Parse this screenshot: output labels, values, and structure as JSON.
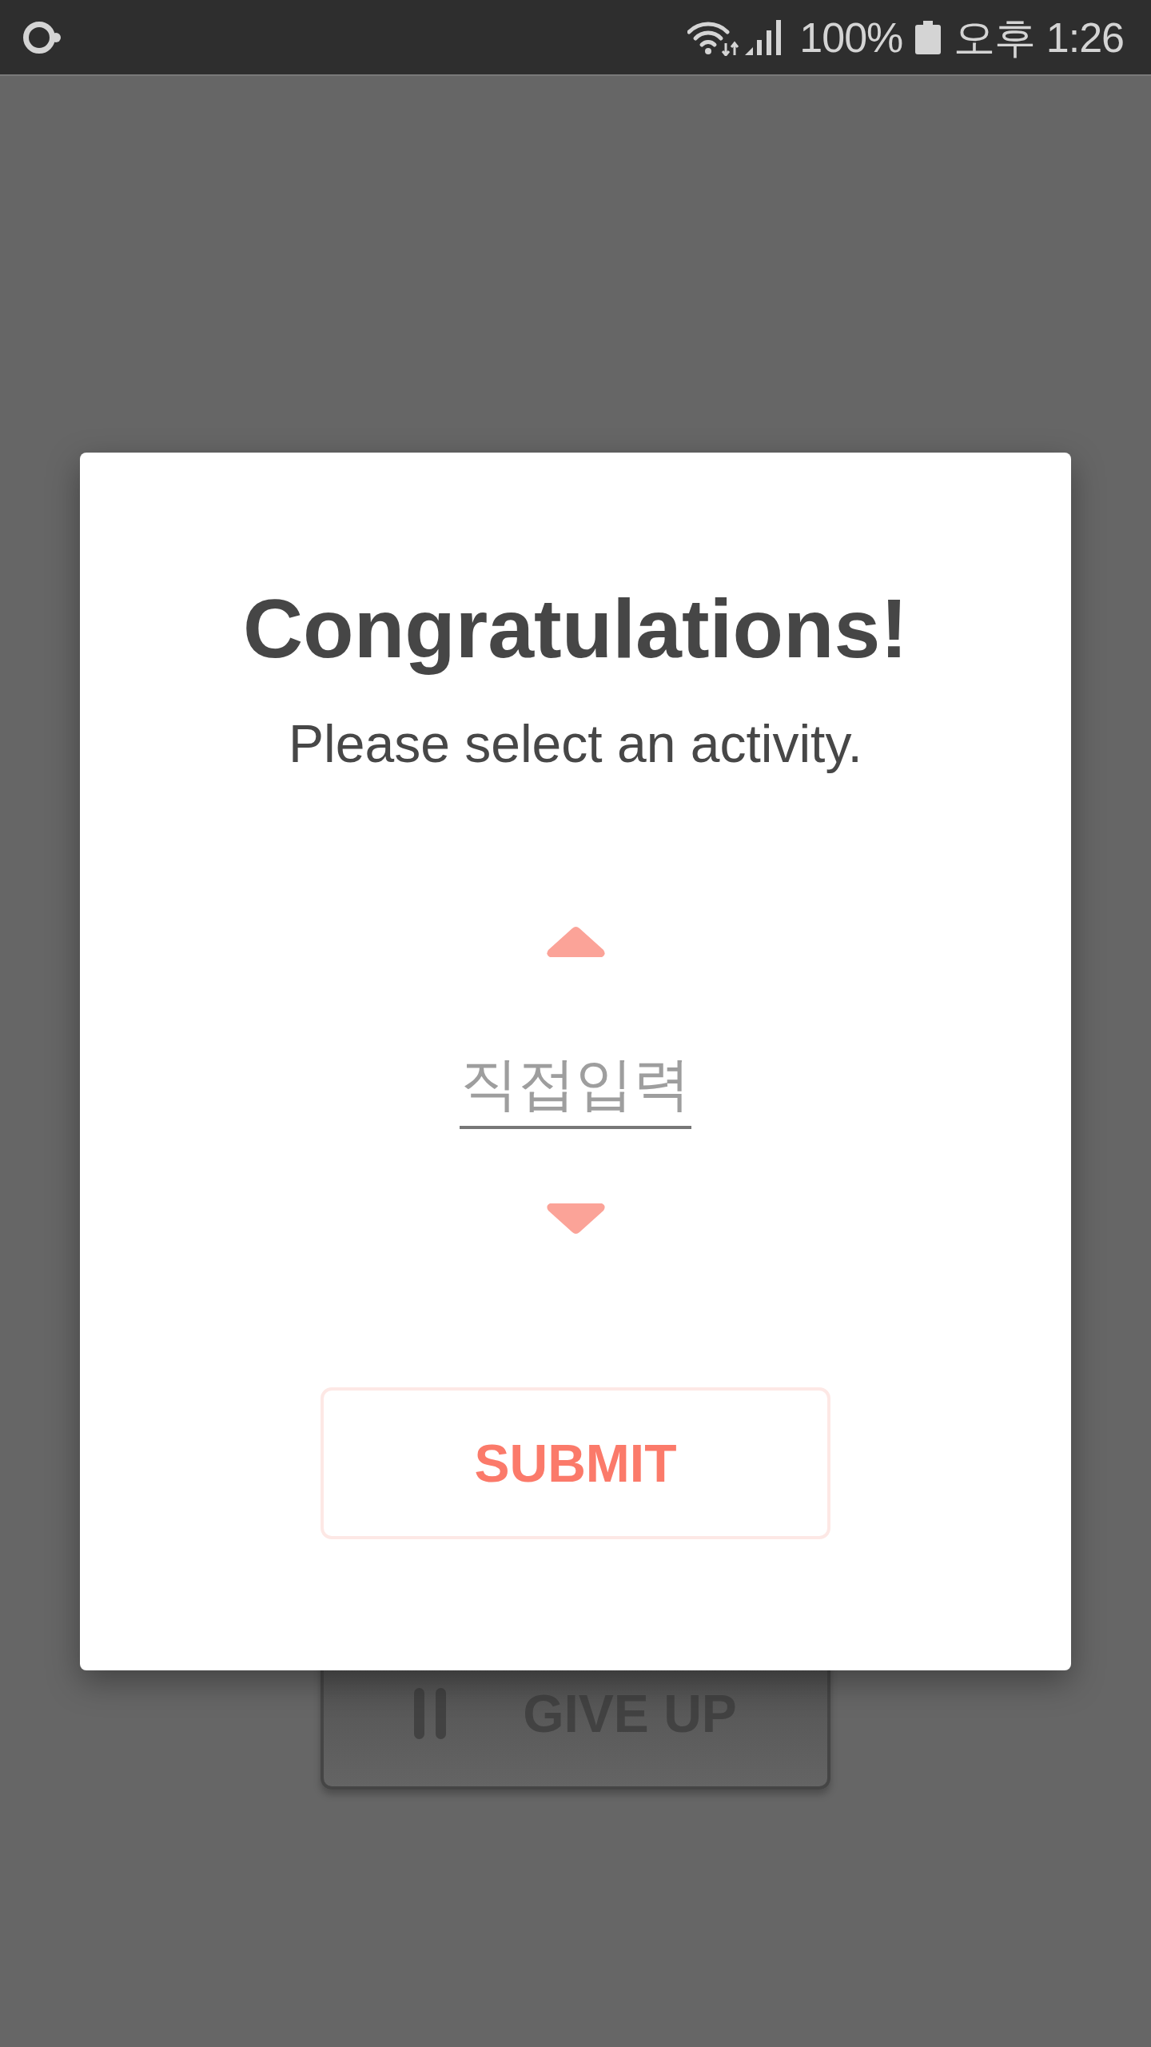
{
  "status_bar": {
    "battery": "100%",
    "time": "오후 1:26"
  },
  "dialog": {
    "title": "Congratulations!",
    "subtitle": "Please select an activity.",
    "picker": {
      "placeholder": "직접입력"
    },
    "submit_button": "SUBMIT"
  },
  "background": {
    "give_up_button": "GIVE UP"
  }
}
